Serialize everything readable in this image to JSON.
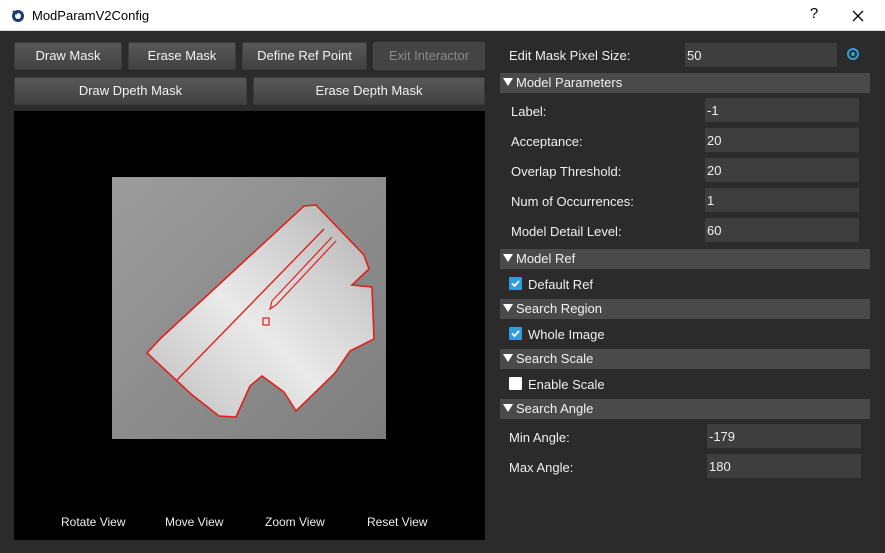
{
  "window": {
    "title": "ModParamV2Config",
    "help_glyph": "?",
    "close_icon": "close-icon",
    "app_icon": "app-logo-icon"
  },
  "toolbar": {
    "draw_mask": "Draw Mask",
    "erase_mask": "Erase Mask",
    "define_ref_point": "Define Ref Point",
    "exit_interactor": "Exit Interactor",
    "draw_depth_mask": "Draw Dpeth Mask",
    "erase_depth_mask": "Erase Depth Mask"
  },
  "viewer": {
    "rotate_view": "Rotate View",
    "move_view": "Move View",
    "zoom_view": "Zoom View",
    "reset_view": "Reset View"
  },
  "edit_mask": {
    "label": "Edit Mask Pixel Size:",
    "value": "50"
  },
  "model_parameters": {
    "title": "Model Parameters",
    "label": {
      "label": "Label:",
      "value": "-1"
    },
    "acceptance": {
      "label": "Acceptance:",
      "value": "20"
    },
    "overlap_threshold": {
      "label": "Overlap Threshold:",
      "value": "20"
    },
    "num_occurrences": {
      "label": "Num of Occurrences:",
      "value": "1"
    },
    "model_detail_level": {
      "label": "Model Detail Level:",
      "value": "60"
    }
  },
  "model_ref": {
    "title": "Model Ref",
    "default_ref_label": "Default Ref",
    "default_ref_checked": true
  },
  "search_region": {
    "title": "Search Region",
    "whole_image_label": "Whole Image",
    "whole_image_checked": true
  },
  "search_scale": {
    "title": "Search Scale",
    "enable_scale_label": "Enable Scale",
    "enable_scale_checked": false
  },
  "search_angle": {
    "title": "Search Angle",
    "min_angle": {
      "label": "Min Angle:",
      "value": "-179"
    },
    "max_angle": {
      "label": "Max Angle:",
      "value": "180"
    }
  },
  "colors": {
    "accent": "#2e9fdc",
    "contour": "#e0201c",
    "panel": "#2b2b2b",
    "section": "#4a4a4a"
  }
}
